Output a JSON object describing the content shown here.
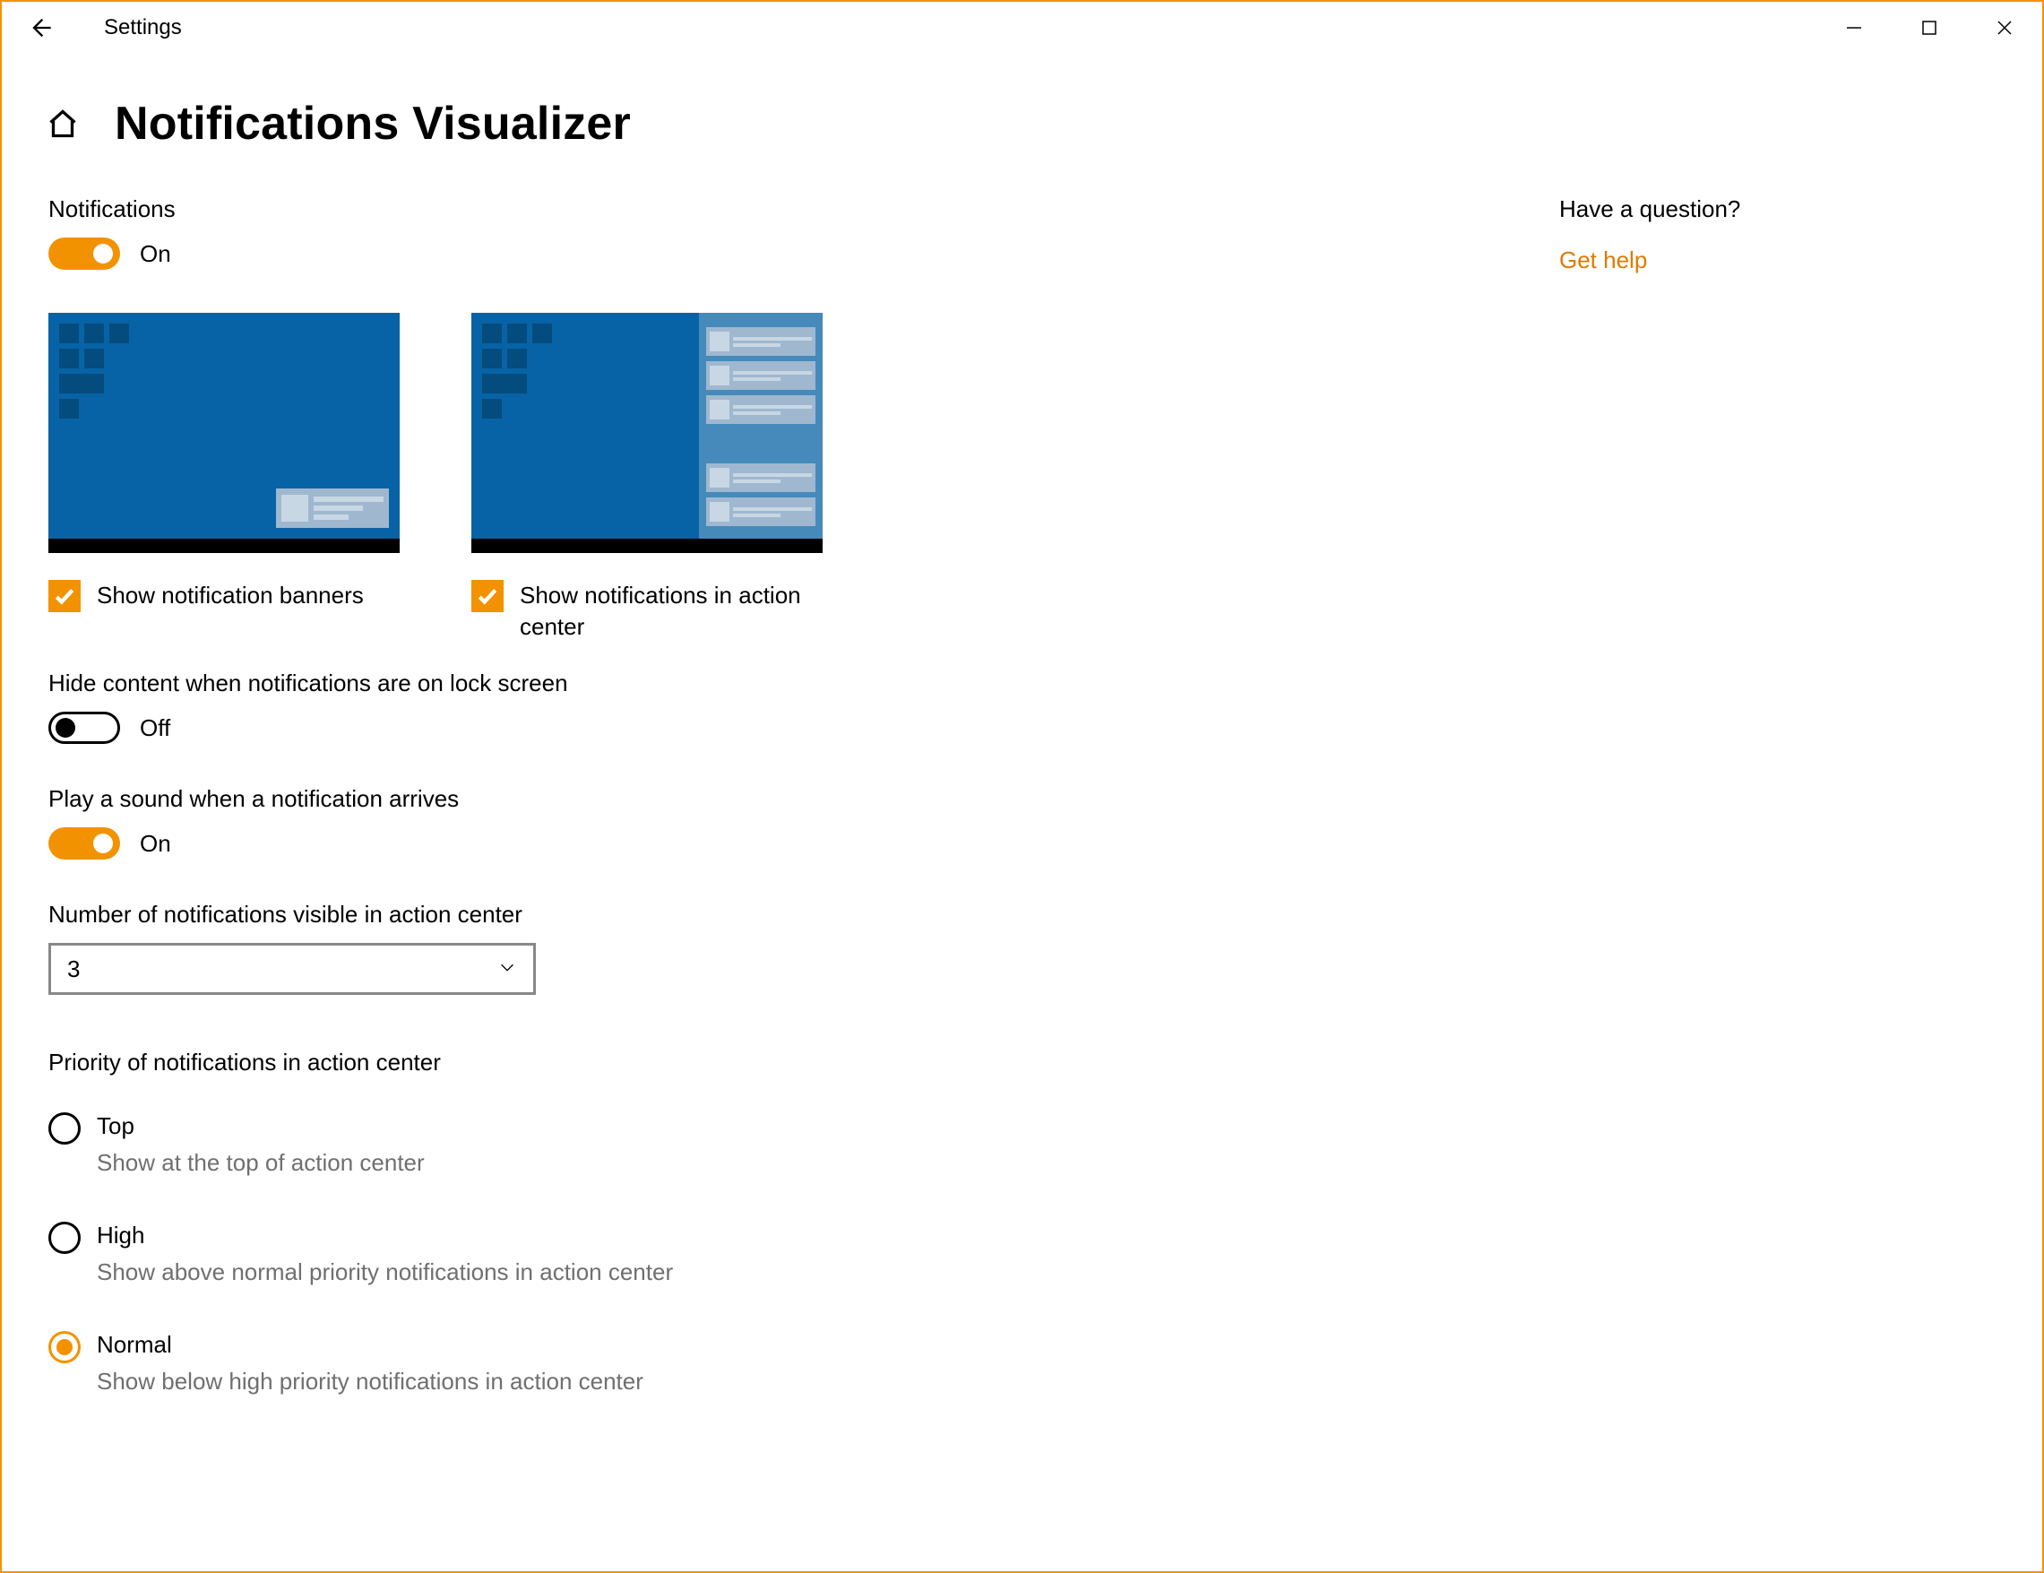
{
  "window": {
    "app_title": "Settings"
  },
  "header": {
    "page_title": "Notifications Visualizer"
  },
  "settings": {
    "notifications": {
      "label": "Notifications",
      "state_text": "On",
      "on": true
    },
    "banner_checkbox_label": "Show notification banners",
    "action_center_checkbox_label": "Show notifications in action center",
    "hide_lock": {
      "label": "Hide content when notifications are on lock screen",
      "state_text": "Off",
      "on": false
    },
    "play_sound": {
      "label": "Play a sound when a notification arrives",
      "state_text": "On",
      "on": true
    },
    "num_visible": {
      "label": "Number of notifications visible in action center",
      "value": "3"
    },
    "priority": {
      "label": "Priority of notifications in action center",
      "options": [
        {
          "label": "Top",
          "desc": "Show at the top of action center",
          "selected": false
        },
        {
          "label": "High",
          "desc": "Show above normal priority notifications in action center",
          "selected": false
        },
        {
          "label": "Normal",
          "desc": "Show below high priority notifications in action center",
          "selected": true
        }
      ]
    }
  },
  "help": {
    "title": "Have a question?",
    "link": "Get help"
  }
}
